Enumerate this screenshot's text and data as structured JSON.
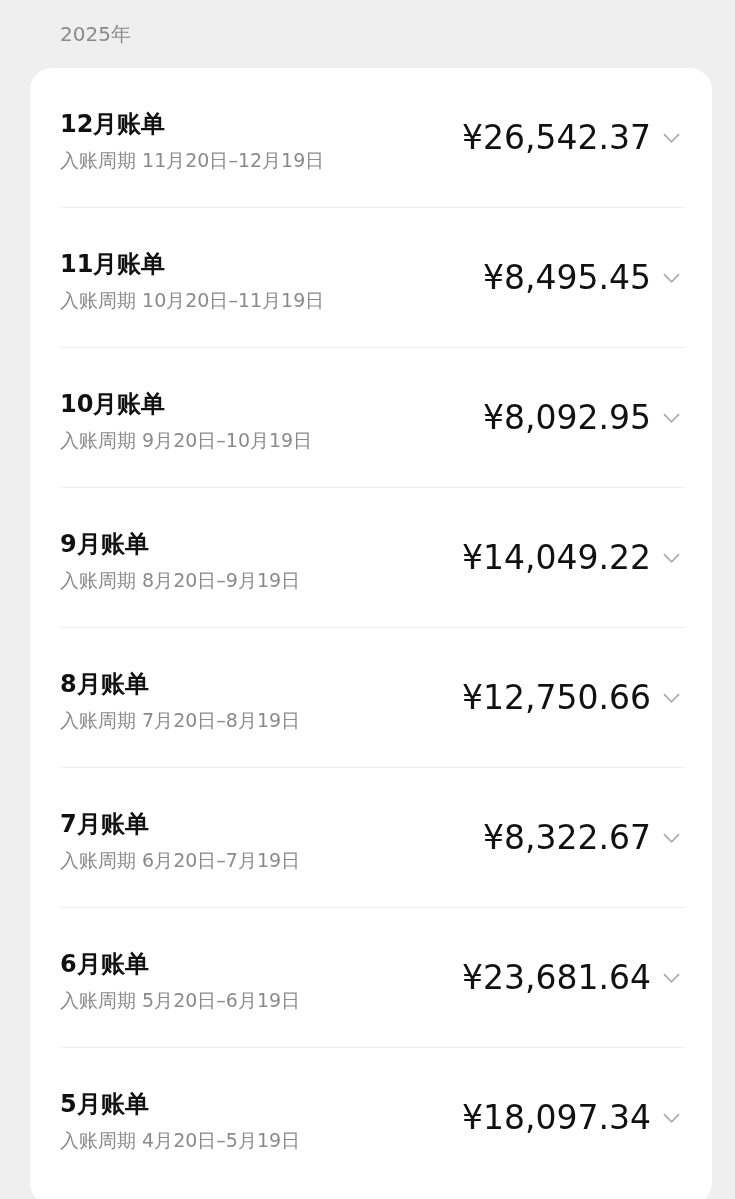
{
  "year_label": "2025年",
  "bills": [
    {
      "title": "12月账单",
      "period": "入账周期 11月20日–12月19日",
      "amount": "¥26,542.37",
      "expanded": false
    },
    {
      "title": "11月账单",
      "period": "入账周期 10月20日–11月19日",
      "amount": "¥8,495.45",
      "expanded": false
    },
    {
      "title": "10月账单",
      "period": "入账周期 9月20日–10月19日",
      "amount": "¥8,092.95",
      "expanded": false
    },
    {
      "title": "9月账单",
      "period": "入账周期 8月20日–9月19日",
      "amount": "¥14,049.22",
      "expanded": false
    },
    {
      "title": "8月账单",
      "period": "入账周期 7月20日–8月19日",
      "amount": "¥12,750.66",
      "expanded": false
    },
    {
      "title": "7月账单",
      "period": "入账周期 6月20日–7月19日",
      "amount": "¥8,322.67",
      "expanded": false
    },
    {
      "title": "6月账单",
      "period": "入账周期 5月20日–6月19日",
      "amount": "¥23,681.64",
      "expanded": false
    },
    {
      "title": "5月账单",
      "period": "入账周期 4月20日–5月19日",
      "amount": "¥18,097.34",
      "expanded": false
    }
  ]
}
